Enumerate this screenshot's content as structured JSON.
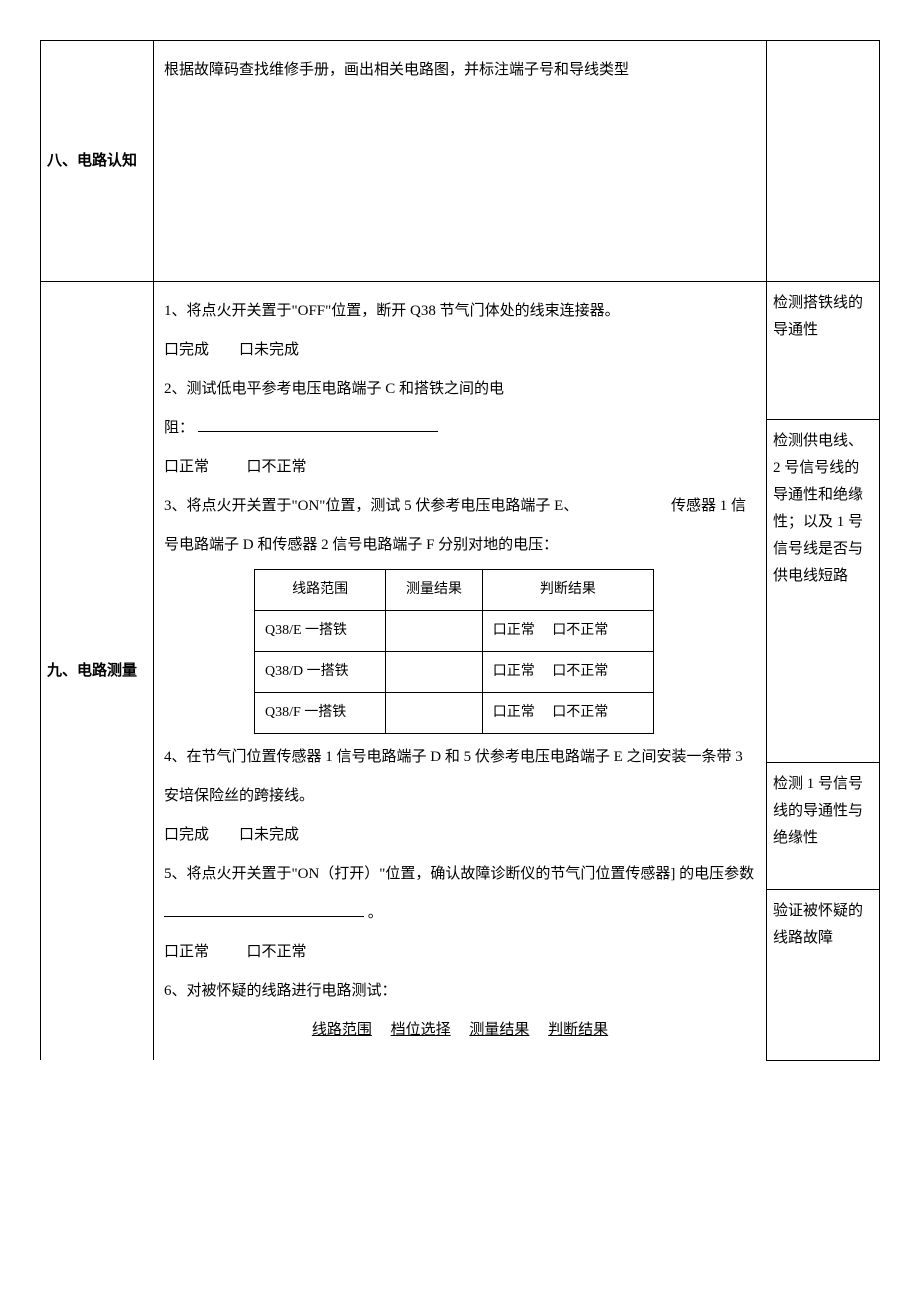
{
  "row8": {
    "title": "八、电路认知",
    "content": "根据故障码查找维修手册，画出相关电路图，并标注端子号和导线类型"
  },
  "row9": {
    "title": "九、电路测量",
    "step1": "1、将点火开关置于\"OFF\"位置，断开 Q38 节气门体处的线束连接器。",
    "done": "口完成",
    "undone": "口未完成",
    "step2": "2、测试低电平参考电压电路端子 C 和搭铁之间的电",
    "step2_label": "阻：",
    "normal": "口正常",
    "abnormal": "口不正常",
    "step3a": "3、将点火开关置于\"ON\"位置，测试 5 伏参考电压电路端子 E、",
    "step3_float": "传感器 1 信",
    "step3b": "号电路端子 D 和传感器 2 信号电路端子 F 分别对地的电压：",
    "tbl": {
      "h1": "线路范围",
      "h2": "测量结果",
      "h3": "判断结果",
      "r1c1": "Q38/E 一搭铁",
      "r2c1": "Q38/D 一搭铁",
      "r3c1": "Q38/F 一搭铁",
      "res_n": "口正常",
      "res_ab": "口不正常"
    },
    "step4": "4、在节气门位置传感器 1 信号电路端子 D 和 5 伏参考电压电路端子 E 之间安装一条带 3 安培保险丝的跨接线。",
    "step5a": "5、将点火开关置于\"ON（打开）\"位置，确认故障诊断仪的节气门位置传感器] 的电压参数",
    "step5b": "。",
    "step6": "6、对被怀疑的线路进行电路测试：",
    "tbl2": {
      "h1": "线路范围",
      "h2": "档位选择",
      "h3": "测量结果",
      "h4": "判断结果"
    },
    "note1": "检测搭铁线的导通性",
    "note2a": "检测供电线、",
    "note2b": "2 号信号线的导通性和绝缘性；以及 1 号信号线是否与供电线短路",
    "note3": "检测 1 号信号线的导通性与绝缘性",
    "note4": "验证被怀疑的线路故障"
  }
}
